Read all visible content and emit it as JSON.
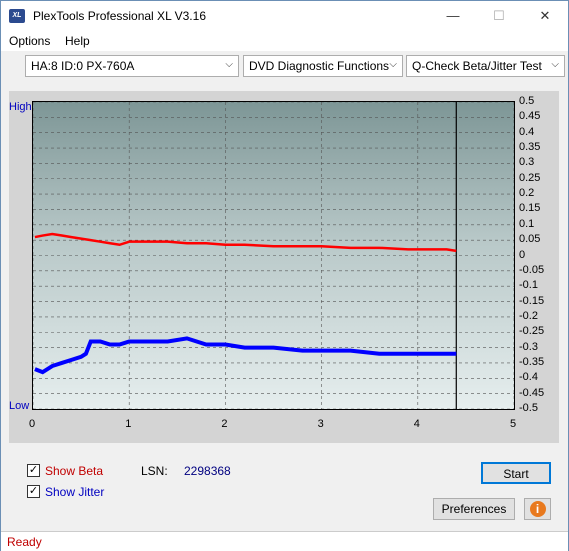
{
  "window": {
    "title": "PlexTools Professional XL V3.16",
    "icon_text": "XL",
    "minimize": "—",
    "maximize": "☐",
    "close": "✕"
  },
  "menu": [
    {
      "label": "Options",
      "accel": "O"
    },
    {
      "label": "Help",
      "accel": "H"
    }
  ],
  "toolbar": {
    "drive": "HA:8 ID:0  PX-760A",
    "function": "DVD Diagnostic Functions",
    "test": "Q-Check Beta/Jitter Test"
  },
  "chart_data": {
    "type": "line",
    "title": "",
    "left_labels": {
      "high": "High",
      "low": "Low"
    },
    "xlabel": "",
    "ylabel": "",
    "xlim": [
      0,
      5
    ],
    "ylim": [
      -0.5,
      0.5
    ],
    "x_ticks": [
      "0",
      "1",
      "2",
      "3",
      "4",
      "5"
    ],
    "y_ticks": [
      "0.5",
      "0.45",
      "0.4",
      "0.35",
      "0.3",
      "0.25",
      "0.2",
      "0.15",
      "0.1",
      "0.05",
      "0",
      "-0.05",
      "-0.1",
      "-0.15",
      "-0.2",
      "-0.25",
      "-0.3",
      "-0.35",
      "-0.4",
      "-0.45",
      "-0.5"
    ],
    "grid": true,
    "end_marker_x": 4.4,
    "series": [
      {
        "name": "Beta",
        "color": "#ff0000",
        "x": [
          0.02,
          0.1,
          0.2,
          0.3,
          0.4,
          0.5,
          0.6,
          0.7,
          0.8,
          0.9,
          1.0,
          1.2,
          1.4,
          1.6,
          1.8,
          2.0,
          2.2,
          2.5,
          2.8,
          3.0,
          3.3,
          3.6,
          3.9,
          4.1,
          4.3,
          4.4
        ],
        "y": [
          0.06,
          0.065,
          0.07,
          0.065,
          0.06,
          0.055,
          0.05,
          0.045,
          0.04,
          0.035,
          0.045,
          0.045,
          0.045,
          0.04,
          0.04,
          0.035,
          0.035,
          0.03,
          0.03,
          0.03,
          0.025,
          0.025,
          0.02,
          0.02,
          0.02,
          0.015
        ]
      },
      {
        "name": "Jitter",
        "color": "#0000ff",
        "x": [
          0.02,
          0.1,
          0.2,
          0.3,
          0.4,
          0.5,
          0.55,
          0.6,
          0.7,
          0.8,
          0.9,
          1.0,
          1.2,
          1.4,
          1.6,
          1.8,
          2.0,
          2.2,
          2.5,
          2.8,
          3.0,
          3.3,
          3.6,
          3.9,
          4.1,
          4.3,
          4.4
        ],
        "y": [
          -0.37,
          -0.38,
          -0.36,
          -0.35,
          -0.34,
          -0.33,
          -0.32,
          -0.28,
          -0.28,
          -0.29,
          -0.29,
          -0.28,
          -0.28,
          -0.28,
          -0.27,
          -0.29,
          -0.29,
          -0.3,
          -0.3,
          -0.31,
          -0.31,
          -0.31,
          -0.32,
          -0.32,
          -0.32,
          -0.32,
          -0.32
        ]
      }
    ]
  },
  "bottom": {
    "show_beta": {
      "label": "Show Beta",
      "checked": true,
      "color": "#c00000"
    },
    "show_jitter": {
      "label": "Show Jitter",
      "checked": true,
      "color": "#0000c0"
    },
    "lsn_label": "LSN:",
    "lsn_value": "2298368",
    "start": "Start",
    "preferences": "Preferences",
    "info_icon": "i"
  },
  "status": "Ready"
}
